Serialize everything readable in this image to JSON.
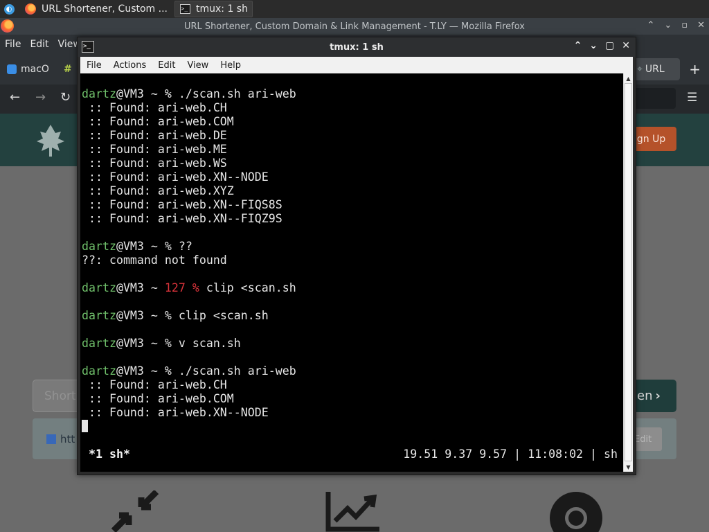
{
  "taskbar": {
    "tasks": [
      {
        "label": "URL Shortener, Custom ...",
        "icon": "firefox-icon"
      },
      {
        "label": "tmux: 1 sh",
        "icon": "terminal-icon"
      }
    ]
  },
  "firefox": {
    "window_title": "URL Shortener, Custom Domain & Link Management - T.LY — Mozilla Firefox",
    "menu": [
      "File",
      "Edit",
      "View"
    ],
    "tabs": [
      {
        "label": "macO"
      },
      {
        "label": "URL"
      }
    ],
    "page": {
      "signup_label": "ign Up",
      "input_placeholder": "Short",
      "shorten_label": "en",
      "result_url": "htt",
      "edit_label": "Edit"
    }
  },
  "terminal": {
    "window_title": "tmux: 1 sh",
    "menu": [
      "File",
      "Actions",
      "Edit",
      "View",
      "Help"
    ],
    "prompt_user": "dartz",
    "prompt_host": "@VM3 ~ ",
    "lines": [
      {
        "type": "prompt",
        "user": "dartz",
        "host": "@VM3 ~ ",
        "code": "",
        "cmd": "% ./scan.sh ari-web"
      },
      {
        "type": "out",
        "text": " :: Found: ari-web.CH"
      },
      {
        "type": "out",
        "text": " :: Found: ari-web.COM"
      },
      {
        "type": "out",
        "text": " :: Found: ari-web.DE"
      },
      {
        "type": "out",
        "text": " :: Found: ari-web.ME"
      },
      {
        "type": "out",
        "text": " :: Found: ari-web.WS"
      },
      {
        "type": "out",
        "text": " :: Found: ari-web.XN--NODE"
      },
      {
        "type": "out",
        "text": " :: Found: ari-web.XYZ"
      },
      {
        "type": "out",
        "text": " :: Found: ari-web.XN--FIQS8S"
      },
      {
        "type": "out",
        "text": " :: Found: ari-web.XN--FIQZ9S"
      },
      {
        "type": "blank"
      },
      {
        "type": "prompt",
        "user": "dartz",
        "host": "@VM3 ~ ",
        "code": "",
        "cmd": "% ??"
      },
      {
        "type": "out",
        "text": "??: command not found"
      },
      {
        "type": "blank"
      },
      {
        "type": "prompt",
        "user": "dartz",
        "host": "@VM3 ~ ",
        "code": "127 %",
        "cmd": " clip <scan.sh"
      },
      {
        "type": "blank"
      },
      {
        "type": "prompt",
        "user": "dartz",
        "host": "@VM3 ~ ",
        "code": "",
        "cmd": "% clip <scan.sh"
      },
      {
        "type": "blank"
      },
      {
        "type": "prompt",
        "user": "dartz",
        "host": "@VM3 ~ ",
        "code": "",
        "cmd": "% v scan.sh"
      },
      {
        "type": "blank"
      },
      {
        "type": "prompt",
        "user": "dartz",
        "host": "@VM3 ~ ",
        "code": "",
        "cmd": "% ./scan.sh ari-web"
      },
      {
        "type": "out",
        "text": " :: Found: ari-web.CH"
      },
      {
        "type": "out",
        "text": " :: Found: ari-web.COM"
      },
      {
        "type": "out",
        "text": " :: Found: ari-web.XN--NODE"
      },
      {
        "type": "cursor"
      }
    ],
    "status_left": "*1 sh*",
    "status_right": "19.51 9.37 9.57 | 11:08:02 | sh",
    "colors": {
      "user": "#6fbf6a",
      "error_code": "#d9333a",
      "background": "#000000"
    }
  }
}
